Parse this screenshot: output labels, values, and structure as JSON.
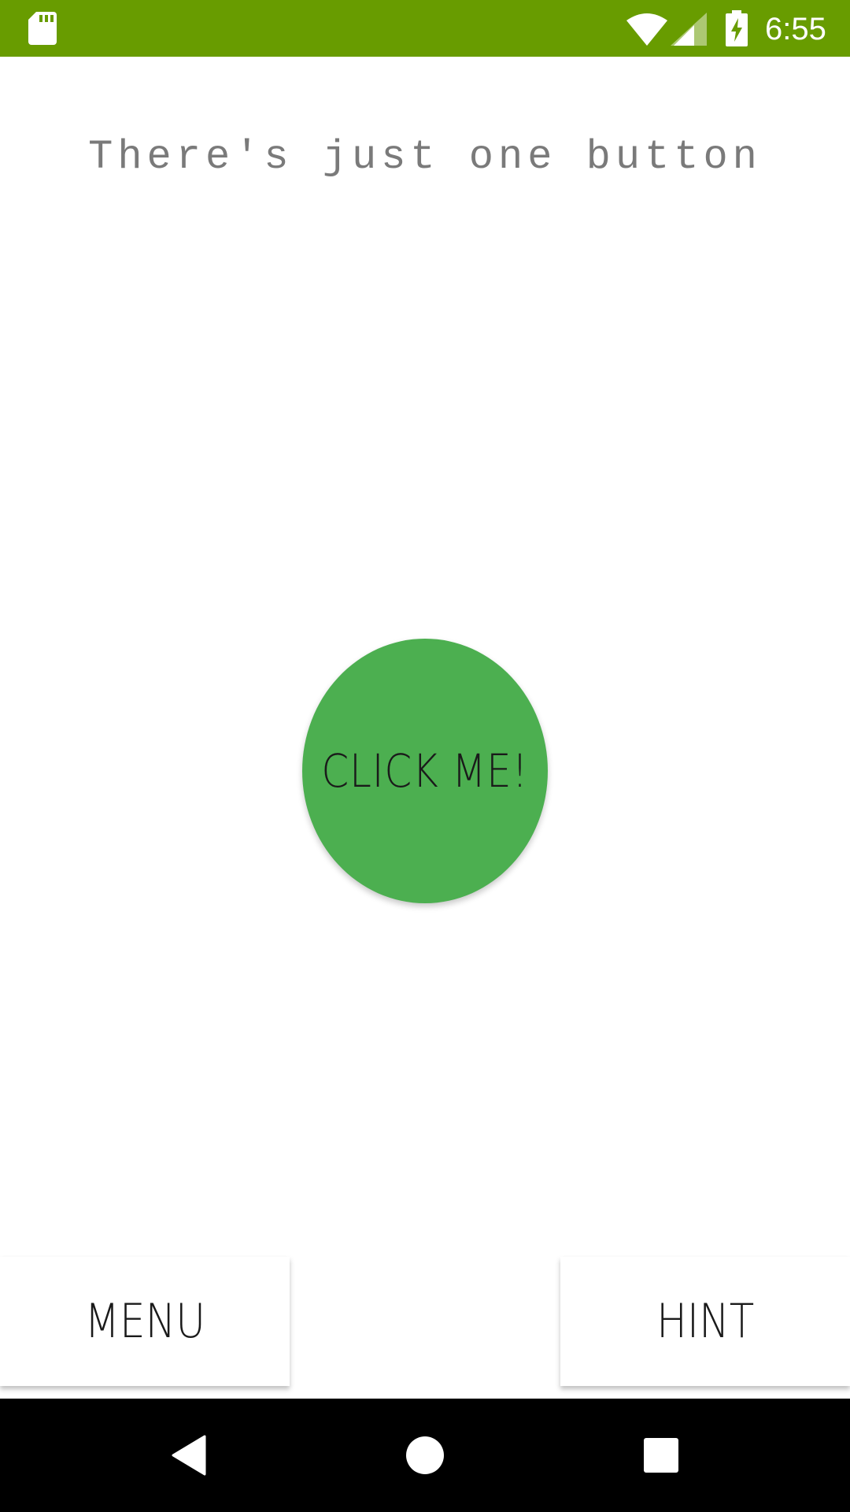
{
  "status_bar": {
    "time": "6:55",
    "background_color": "#689c00",
    "icons": [
      "sd-card-icon",
      "wifi-icon",
      "cell-signal-icon",
      "battery-charging-icon"
    ]
  },
  "headline": "There's just one button",
  "main_button": {
    "label": "CLICK ME!",
    "color": "#4caf50"
  },
  "bottom_buttons": {
    "menu_label": "MENU",
    "hint_label": "HINT"
  },
  "nav_bar": {
    "icons": [
      "back-icon",
      "home-icon",
      "recent-apps-icon"
    ]
  }
}
